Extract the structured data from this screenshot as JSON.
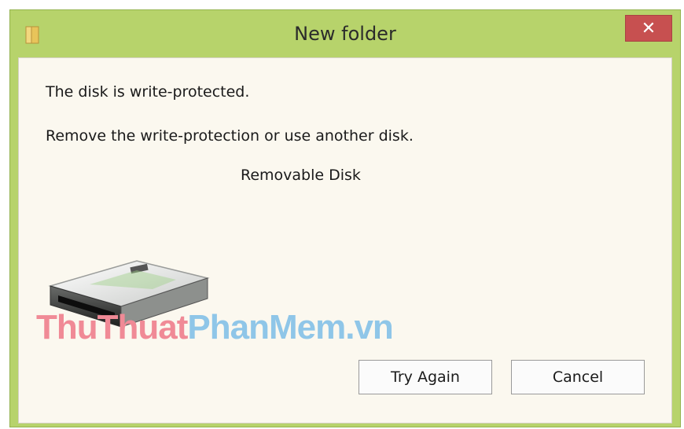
{
  "window": {
    "title": "New folder",
    "close_glyph": "✕",
    "accent": "#b7d36b",
    "close_color": "#c75050"
  },
  "dialog": {
    "message_primary": "The disk is write-protected.",
    "message_secondary": "Remove the write-protection or use another disk.",
    "device_name": "Removable Disk",
    "device_icon": "removable-disk-icon"
  },
  "watermark": {
    "part1": "ThuThuat",
    "part2": "PhanMem",
    "part3": ".vn"
  },
  "buttons": {
    "try_again": "Try Again",
    "cancel": "Cancel"
  }
}
